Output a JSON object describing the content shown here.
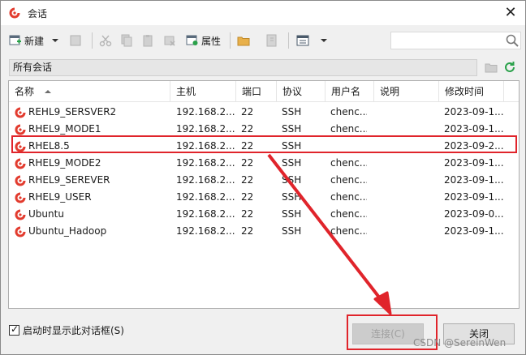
{
  "window": {
    "title": "会话",
    "close_glyph": "✕"
  },
  "toolbar": {
    "new_label": "新建",
    "properties_label": "属性",
    "search_placeholder": ""
  },
  "pathbar": {
    "label": "所有会话"
  },
  "table": {
    "columns": [
      "名称",
      "主机",
      "端口",
      "协议",
      "用户名",
      "说明",
      "修改时间"
    ],
    "rows": [
      {
        "name": "REHL9_SERSVER2",
        "host": "192.168.2...",
        "port": "22",
        "protocol": "SSH",
        "user": "chenc...",
        "desc": "",
        "modified": "2023-09-1..."
      },
      {
        "name": "RHEL9_MODE1",
        "host": "192.168.2...",
        "port": "22",
        "protocol": "SSH",
        "user": "chenc...",
        "desc": "",
        "modified": "2023-09-1..."
      },
      {
        "name": "RHEL8.5",
        "host": "192.168.2...",
        "port": "22",
        "protocol": "SSH",
        "user": "",
        "desc": "",
        "modified": "2023-09-2..."
      },
      {
        "name": "RHEL9_MODE2",
        "host": "192.168.2...",
        "port": "22",
        "protocol": "SSH",
        "user": "chenc...",
        "desc": "",
        "modified": "2023-09-1..."
      },
      {
        "name": "RHEL9_SEREVER",
        "host": "192.168.2...",
        "port": "22",
        "protocol": "SSH",
        "user": "chenc...",
        "desc": "",
        "modified": "2023-09-1..."
      },
      {
        "name": "RHEL9_USER",
        "host": "192.168.2...",
        "port": "22",
        "protocol": "SSH",
        "user": "chenc...",
        "desc": "",
        "modified": "2023-09-1..."
      },
      {
        "name": "Ubuntu",
        "host": "192.168.2...",
        "port": "22",
        "protocol": "SSH",
        "user": "chenc...",
        "desc": "",
        "modified": "2023-09-0..."
      },
      {
        "name": "Ubuntu_Hadoop",
        "host": "192.168.2...",
        "port": "22",
        "protocol": "SSH",
        "user": "chenc...",
        "desc": "",
        "modified": "2023-09-1..."
      }
    ]
  },
  "footer": {
    "show_on_startup_label": "启动时显示此对话框(S)",
    "show_on_startup_checked": true,
    "connect_label": "连接(C)",
    "close_label": "关闭",
    "watermark": "CSDN @SereinWen"
  },
  "colors": {
    "accent_red": "#e0242b",
    "session_icon": "#e23b2e",
    "refresh_green": "#2aa14a"
  },
  "icons": [
    "session-icon",
    "new-session-icon",
    "cut-icon",
    "copy-icon",
    "paste-icon",
    "delete-icon",
    "properties-icon",
    "folder-icon",
    "terminal-icon",
    "view-icon",
    "search-icon",
    "refresh-icon"
  ]
}
